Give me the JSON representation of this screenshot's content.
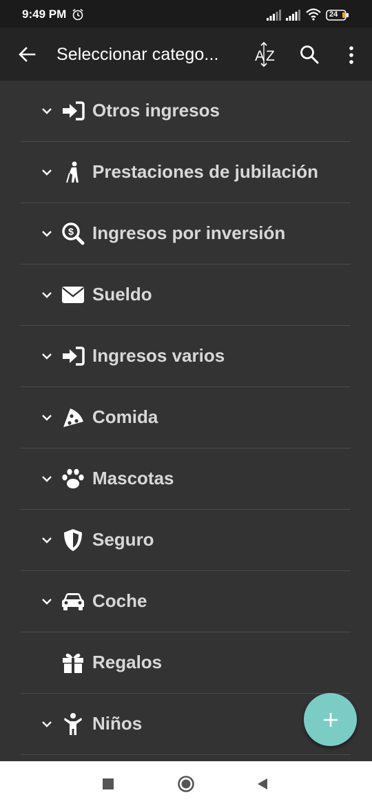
{
  "status_bar": {
    "time": "9:49 PM",
    "battery": "24"
  },
  "app_bar": {
    "title": "Seleccionar catego...",
    "back_icon": "arrow-back-icon",
    "sort_icon": "sort-az-icon",
    "search_icon": "search-icon",
    "more_icon": "more-vert-icon"
  },
  "categories": [
    {
      "label": "Otros ingresos",
      "icon": "sign-in-icon",
      "expandable": true
    },
    {
      "label": "Prestaciones de jubilación",
      "icon": "elderly-person-icon",
      "expandable": true
    },
    {
      "label": "Ingresos por inversión",
      "icon": "search-dollar-icon",
      "expandable": true
    },
    {
      "label": "Sueldo",
      "icon": "envelope-icon",
      "expandable": true
    },
    {
      "label": "Ingresos varios",
      "icon": "sign-in-icon",
      "expandable": true
    },
    {
      "label": "Comida",
      "icon": "pizza-slice-icon",
      "expandable": true
    },
    {
      "label": "Mascotas",
      "icon": "paw-icon",
      "expandable": true
    },
    {
      "label": "Seguro",
      "icon": "shield-icon",
      "expandable": true
    },
    {
      "label": "Coche",
      "icon": "car-icon",
      "expandable": true
    },
    {
      "label": "Regalos",
      "icon": "gift-icon",
      "expandable": false
    },
    {
      "label": "Niños",
      "icon": "child-icon",
      "expandable": true
    }
  ],
  "fab": {
    "icon": "plus-icon",
    "color": "#7cccc6"
  },
  "colors": {
    "background": "#333333",
    "app_bar": "#242424",
    "status_bar": "#1b1b1b",
    "label": "#d8d8d8",
    "accent": "#7cccc6"
  }
}
